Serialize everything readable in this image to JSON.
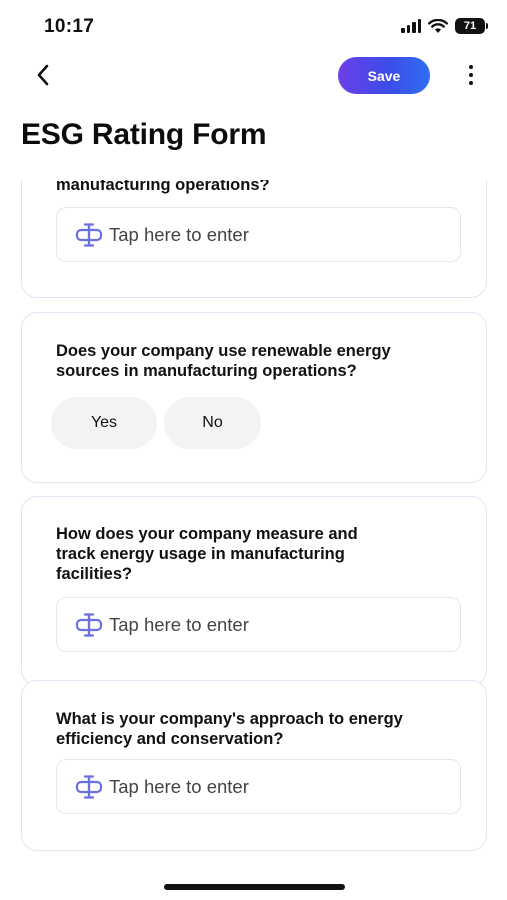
{
  "status_bar": {
    "time": "10:17",
    "battery": "71"
  },
  "nav": {
    "back_icon": "chevron-left-icon",
    "save_label": "Save",
    "more_icon": "more-vertical-icon"
  },
  "page": {
    "title": "ESG Rating Form"
  },
  "colors": {
    "accent_start": "#6c3fe8",
    "accent_end": "#2f6df0",
    "icon": "#6b6fe0",
    "card_border": "#dde6f2"
  },
  "form": {
    "cards": [
      {
        "question_fragment": "manufacturing operations?",
        "input_placeholder": "Tap here to enter"
      },
      {
        "question": "Does your company use renewable energy sources in manufacturing operations?",
        "options": [
          "Yes",
          "No"
        ]
      },
      {
        "question": "How does your company measure and track energy usage in manufacturing facilities?",
        "input_placeholder": "Tap here to enter"
      },
      {
        "question": "What is your company's approach to energy efficiency and conservation?",
        "input_placeholder": "Tap here to enter"
      }
    ]
  }
}
